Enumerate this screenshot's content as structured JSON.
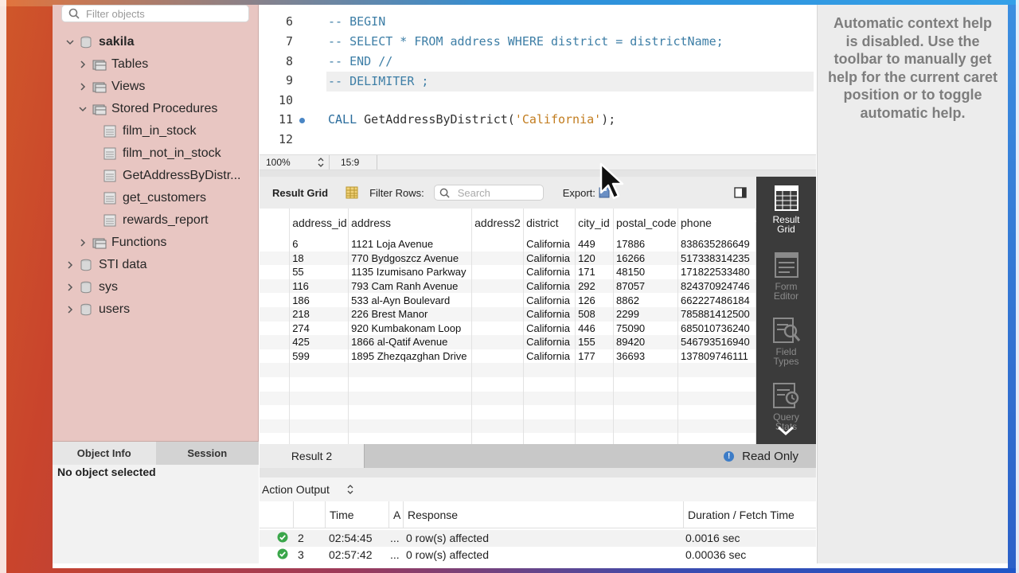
{
  "sidebar": {
    "filter_placeholder": "Filter objects",
    "tree": {
      "schema": "sakila",
      "tables": "Tables",
      "views": "Views",
      "stored_procedures": "Stored Procedures",
      "procedures": [
        "film_in_stock",
        "film_not_in_stock",
        "GetAddressByDistr...",
        "get_customers",
        "rewards_report"
      ],
      "functions": "Functions",
      "other_schemas": [
        "STI data",
        "sys",
        "users"
      ]
    },
    "tabs": {
      "object_info": "Object Info",
      "session": "Session"
    },
    "info_text": "No object selected"
  },
  "editor": {
    "lines": [
      {
        "n": "6",
        "text": "-- BEGIN"
      },
      {
        "n": "7",
        "text": "-- SELECT * FROM address WHERE district = districtName;"
      },
      {
        "n": "8",
        "text": "-- END //"
      },
      {
        "n": "9",
        "text": "-- DELIMITER ;"
      },
      {
        "n": "10",
        "text": ""
      },
      {
        "n": "11",
        "text": "CALL GetAddressByDistrict('California');"
      },
      {
        "n": "12",
        "text": ""
      }
    ],
    "call_keyword": "CALL",
    "call_fn": "GetAddressByDistrict(",
    "call_arg": "'California'",
    "call_tail": ");",
    "zoom": "100%",
    "cursor_pos": "15:9"
  },
  "result_toolbar": {
    "result_grid_label": "Result Grid",
    "filter_rows_label": "Filter Rows:",
    "search_placeholder": "Search",
    "export_label": "Export:"
  },
  "grid": {
    "columns": [
      "address_id",
      "address",
      "address2",
      "district",
      "city_id",
      "postal_code",
      "phone"
    ],
    "rows": [
      [
        "6",
        "1121 Loja Avenue",
        "",
        "California",
        "449",
        "17886",
        "838635286649"
      ],
      [
        "18",
        "770 Bydgoszcz Avenue",
        "",
        "California",
        "120",
        "16266",
        "517338314235"
      ],
      [
        "55",
        "1135 Izumisano Parkway",
        "",
        "California",
        "171",
        "48150",
        "171822533480"
      ],
      [
        "116",
        "793 Cam Ranh Avenue",
        "",
        "California",
        "292",
        "87057",
        "824370924746"
      ],
      [
        "186",
        "533 al-Ayn Boulevard",
        "",
        "California",
        "126",
        "8862",
        "662227486184"
      ],
      [
        "218",
        "226 Brest Manor",
        "",
        "California",
        "508",
        "2299",
        "785881412500"
      ],
      [
        "274",
        "920 Kumbakonam Loop",
        "",
        "California",
        "446",
        "75090",
        "685010736240"
      ],
      [
        "425",
        "1866 al-Qatif Avenue",
        "",
        "California",
        "155",
        "89420",
        "546793516940"
      ],
      [
        "599",
        "1895 Zhezqazghan Drive",
        "",
        "California",
        "177",
        "36693",
        "137809746111"
      ]
    ]
  },
  "side_tools": {
    "result_grid": [
      "Result",
      "Grid"
    ],
    "form_editor": [
      "Form",
      "Editor"
    ],
    "field_types": [
      "Field",
      "Types"
    ],
    "query_stats": [
      "Query",
      "Stats"
    ]
  },
  "result_tabs": {
    "tab": "Result 2",
    "read_only": "Read Only"
  },
  "action_output": {
    "title": "Action Output",
    "columns": {
      "time": "Time",
      "action": "A",
      "response": "Response",
      "duration": "Duration / Fetch Time"
    },
    "rows": [
      {
        "n": "2",
        "time": "02:54:45",
        "action": "...",
        "response": "0 row(s) affected",
        "duration": "0.0016 sec"
      },
      {
        "n": "3",
        "time": "02:57:42",
        "action": "...",
        "response": "0 row(s) affected",
        "duration": "0.00036 sec"
      }
    ]
  },
  "help": {
    "text": "Automatic context help is disabled. Use the toolbar to manually get help for the current caret position or to toggle automatic help."
  },
  "colors": {
    "sidebar_bg": "#e8c6c2",
    "comment": "#3d7ea6",
    "string": "#c27c1e",
    "ok_green": "#3aa64a"
  }
}
